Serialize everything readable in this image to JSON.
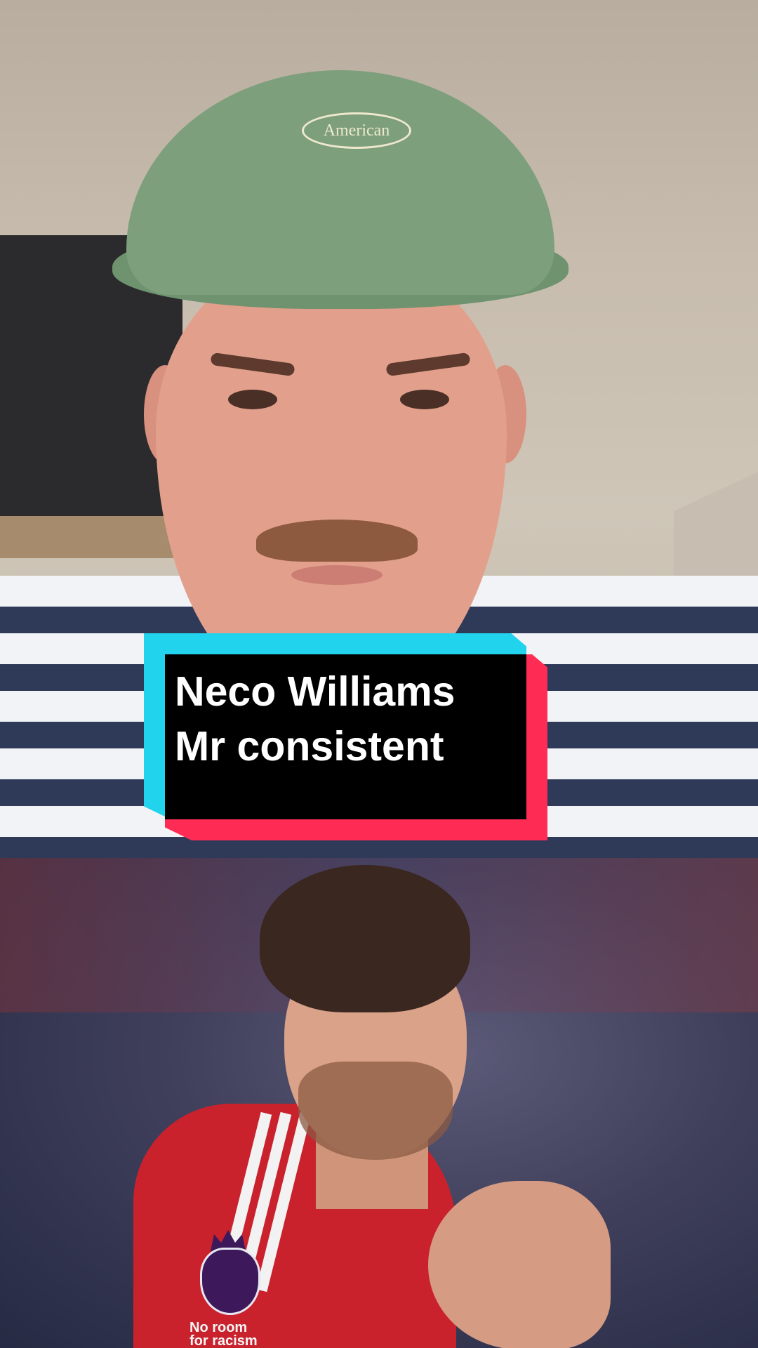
{
  "caption": {
    "line1": "Neco Williams",
    "line2": "Mr consistent"
  },
  "cap_badge_text": "American",
  "sleeve_patch": {
    "line1": "No room",
    "line2": "for racism"
  },
  "colors": {
    "caption_cyan": "#22d3ee",
    "caption_red": "#fe2c55",
    "caption_bg": "#000000",
    "caption_text": "#ffffff"
  }
}
